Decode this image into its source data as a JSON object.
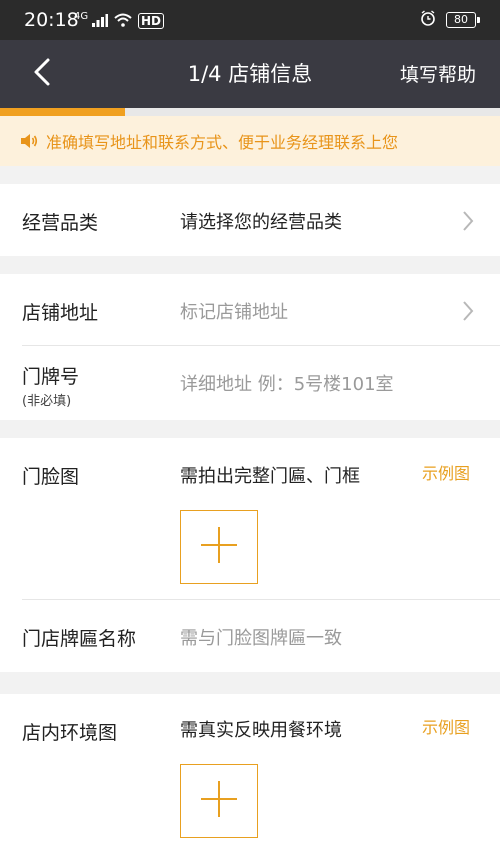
{
  "status": {
    "time": "20:18",
    "network": "4G",
    "hd": "HD",
    "battery": "80"
  },
  "nav": {
    "title": "1/4 店铺信息",
    "help": "填写帮助"
  },
  "progress": {
    "step": 1,
    "total": 4
  },
  "notice": {
    "text": "准确填写地址和联系方式、便于业务经理联系上您"
  },
  "form": {
    "category": {
      "label": "经营品类",
      "placeholder": "请选择您的经营品类"
    },
    "address": {
      "label": "店铺地址",
      "placeholder": "标记店铺地址"
    },
    "door_number": {
      "label": "门牌号",
      "sub": "(非必填)",
      "placeholder": "详细地址 例：5号楼101室"
    },
    "storefront": {
      "label": "门脸图",
      "hint": "需拍出完整门匾、门框",
      "sample": "示例图"
    },
    "sign_name": {
      "label": "门店牌匾名称",
      "placeholder": "需与门脸图牌匾一致"
    },
    "interior": {
      "label": "店内环境图",
      "hint": "需真实反映用餐环境",
      "sample": "示例图"
    }
  },
  "colors": {
    "accent": "#e8a020",
    "nav_bg": "#3a3a42",
    "notice_bg": "#fdf1dc"
  }
}
